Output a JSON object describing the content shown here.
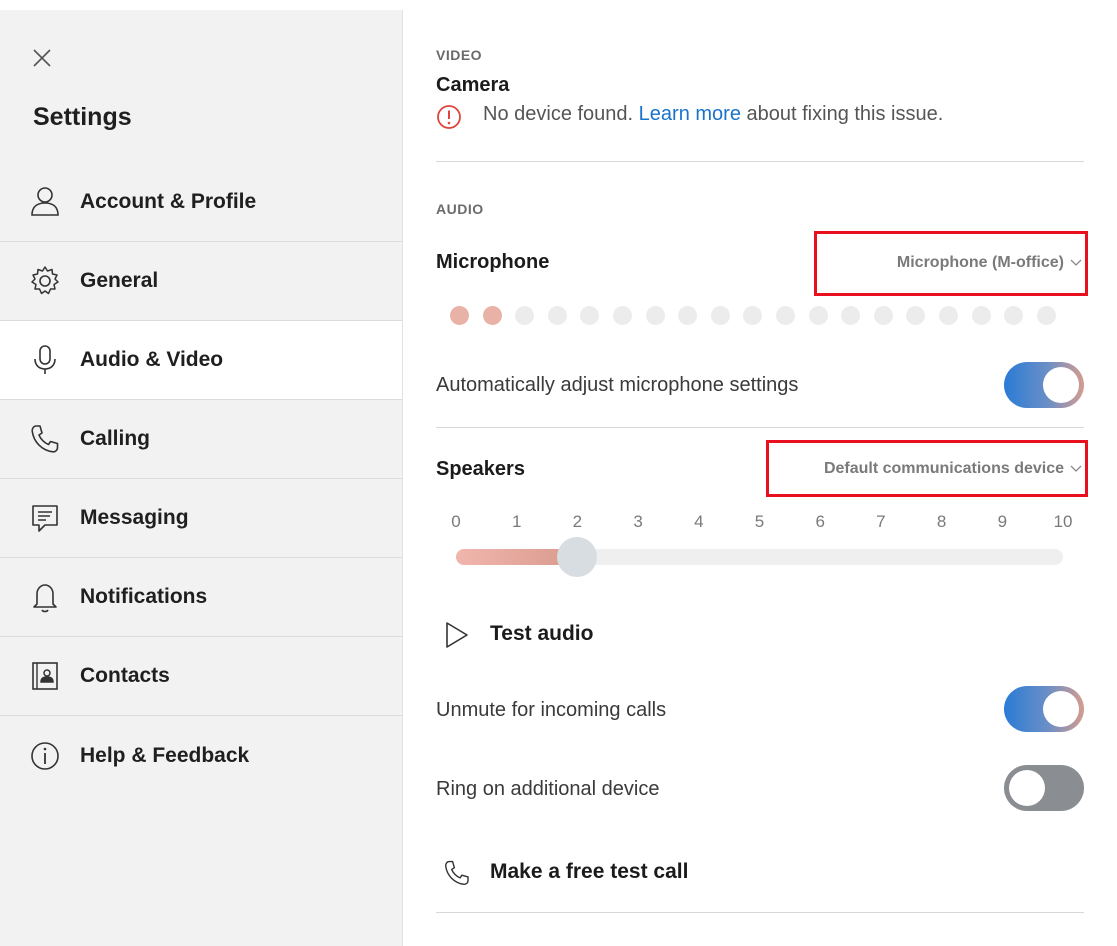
{
  "sidebar": {
    "title": "Settings",
    "items": [
      {
        "label": "Account & Profile",
        "icon": "person-icon"
      },
      {
        "label": "General",
        "icon": "gear-icon"
      },
      {
        "label": "Audio & Video",
        "icon": "microphone-icon",
        "active": true
      },
      {
        "label": "Calling",
        "icon": "phone-icon"
      },
      {
        "label": "Messaging",
        "icon": "chat-icon"
      },
      {
        "label": "Notifications",
        "icon": "bell-icon"
      },
      {
        "label": "Contacts",
        "icon": "contact-card-icon"
      },
      {
        "label": "Help & Feedback",
        "icon": "info-icon"
      }
    ]
  },
  "video": {
    "section_label": "VIDEO",
    "camera_title": "Camera",
    "warning_prefix": "No device found.",
    "warning_link": "Learn more",
    "warning_suffix": "about fixing this issue."
  },
  "audio": {
    "section_label": "AUDIO",
    "microphone_title": "Microphone",
    "microphone_device": "Microphone (M-office)",
    "mic_level_active_dots": 2,
    "mic_level_total_dots": 19,
    "auto_adjust_label": "Automatically adjust microphone settings",
    "auto_adjust_on": true,
    "speakers_title": "Speakers",
    "speakers_device": "Default communications device",
    "volume_ticks": [
      "0",
      "1",
      "2",
      "3",
      "4",
      "5",
      "6",
      "7",
      "8",
      "9",
      "10"
    ],
    "volume_value": 2,
    "test_audio_label": "Test audio",
    "unmute_label": "Unmute for incoming calls",
    "unmute_on": true,
    "ring_label": "Ring on additional device",
    "ring_on": false,
    "test_call_label": "Make a free test call"
  },
  "colors": {
    "accent": "#1a73c9",
    "highlight": "#e8101f",
    "warning": "#e0443a"
  }
}
